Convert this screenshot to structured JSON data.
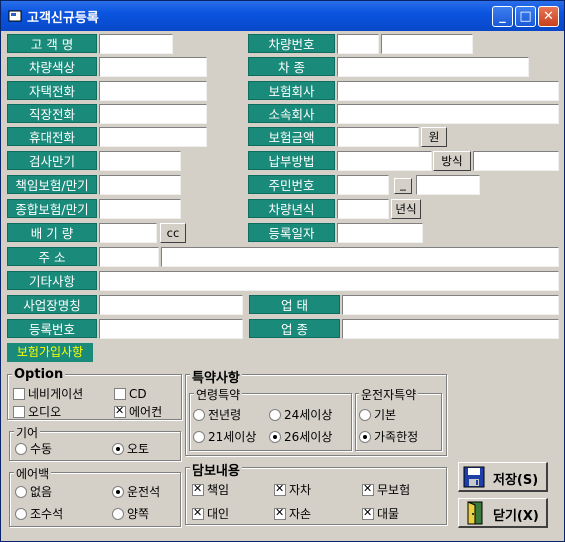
{
  "window": {
    "title": "고객신규등록",
    "controls": {
      "minimize": "_",
      "maximize": "□",
      "close": "✕"
    }
  },
  "labels": {
    "name": "고 객 명",
    "car_no": "차량번호",
    "car_color": "차량색상",
    "car_type": "차    종",
    "home_phone": "자택전화",
    "insurer": "보험회사",
    "work_phone": "직장전화",
    "company": "소속회사",
    "mobile": "휴대전화",
    "ins_amount": "보험금액",
    "inspection": "검사만기",
    "payment": "납부방법",
    "liability": "책임보험/만기",
    "resident_no": "주민번호",
    "comprehensive": "종합보험/만기",
    "car_year": "차량년식",
    "displacement": "배 기 량",
    "reg_date": "등록일자",
    "address": "주    소",
    "remarks": "기타사항",
    "business_name": "사업장명칭",
    "business_type": "업    태",
    "reg_number": "등록번호",
    "business_item": "업    종"
  },
  "unit_buttons": {
    "won": "원",
    "method": "방식",
    "dash": "_",
    "year": "년식",
    "cc": "cc"
  },
  "section_tab": "보험가입사항",
  "option_group": {
    "title": "Option",
    "items": [
      {
        "label": "네비게이션",
        "checked": false
      },
      {
        "label": "CD",
        "checked": false
      },
      {
        "label": "오디오",
        "checked": false
      },
      {
        "label": "에어컨",
        "checked": true
      }
    ]
  },
  "gear_group": {
    "title": "기어",
    "items": [
      {
        "label": "수동",
        "selected": false
      },
      {
        "label": "오토",
        "selected": true
      }
    ]
  },
  "airbag_group": {
    "title": "에어백",
    "items": [
      {
        "label": "없음",
        "selected": false
      },
      {
        "label": "운전석",
        "selected": true
      },
      {
        "label": "조수석",
        "selected": false
      },
      {
        "label": "양쪽",
        "selected": false
      }
    ]
  },
  "special_group": {
    "title": "특약사항"
  },
  "age_group": {
    "title": "연령특약",
    "items": [
      {
        "label": "전년령",
        "selected": false
      },
      {
        "label": "24세이상",
        "selected": false
      },
      {
        "label": "21세이상",
        "selected": false
      },
      {
        "label": "26세이상",
        "selected": true
      }
    ]
  },
  "driver_group": {
    "title": "운전자특약",
    "items": [
      {
        "label": "기본",
        "selected": false
      },
      {
        "label": "가족한정",
        "selected": true
      }
    ]
  },
  "coverage_group": {
    "title": "담보내용",
    "items": [
      {
        "label": "책임",
        "checked": true
      },
      {
        "label": "자차",
        "checked": true
      },
      {
        "label": "무보험",
        "checked": true
      },
      {
        "label": "대인",
        "checked": true
      },
      {
        "label": "자손",
        "checked": true
      },
      {
        "label": "대물",
        "checked": true
      }
    ]
  },
  "actions": {
    "save": "저장(S)",
    "close": "닫기(X)"
  }
}
